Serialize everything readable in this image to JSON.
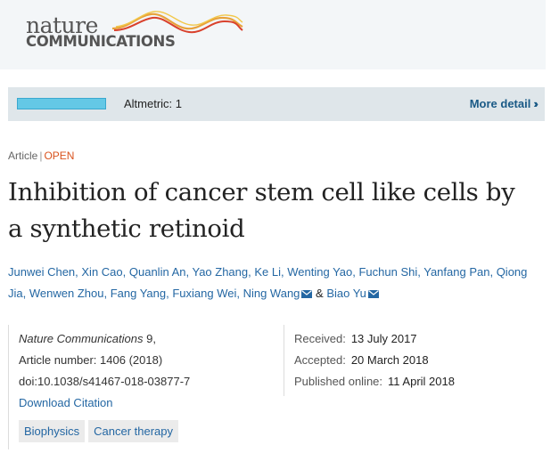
{
  "header": {
    "logo_nature": "nature",
    "logo_communications": "COMMUNICATIONS"
  },
  "altmetric": {
    "label": "Altmetric: 1",
    "more_label": "More detail",
    "more_icon": "double-chevron-right-icon",
    "meter_color": "#64c8e6"
  },
  "article": {
    "type": "Article",
    "access": "OPEN",
    "title_line1": "Inhibition of cancer stem cell like cells by",
    "title_line2": "a synthetic retinoid"
  },
  "authors": [
    "Junwei Chen",
    "Xin Cao",
    "Quanlin An",
    "Yao Zhang",
    "Ke Li",
    "Wenting Yao",
    "Fuchun Shi",
    "Yanfang Pan",
    "Qiong Jia",
    "Wenwen Zhou",
    "Fang Yang",
    "Fuxiang Wei",
    "Ning Wang",
    "Biao Yu"
  ],
  "authors_and": "&",
  "citation": {
    "journal": "Nature Communications",
    "volume": "9",
    "article_number": "Article number: 1406 (2018)",
    "doi": "doi:10.1038/s41467-018-03877-7",
    "download_label": "Download Citation",
    "subjects": [
      "Biophysics",
      "Cancer therapy"
    ]
  },
  "dates": {
    "received_label": "Received:",
    "received": "13 July 2017",
    "accepted_label": "Accepted:",
    "accepted": "20 March 2018",
    "published_label": "Published online:",
    "published": "11 April 2018"
  },
  "colors": {
    "link": "#2467a3",
    "open_accent": "#d9531e",
    "header_bg": "#f3f6f8"
  }
}
